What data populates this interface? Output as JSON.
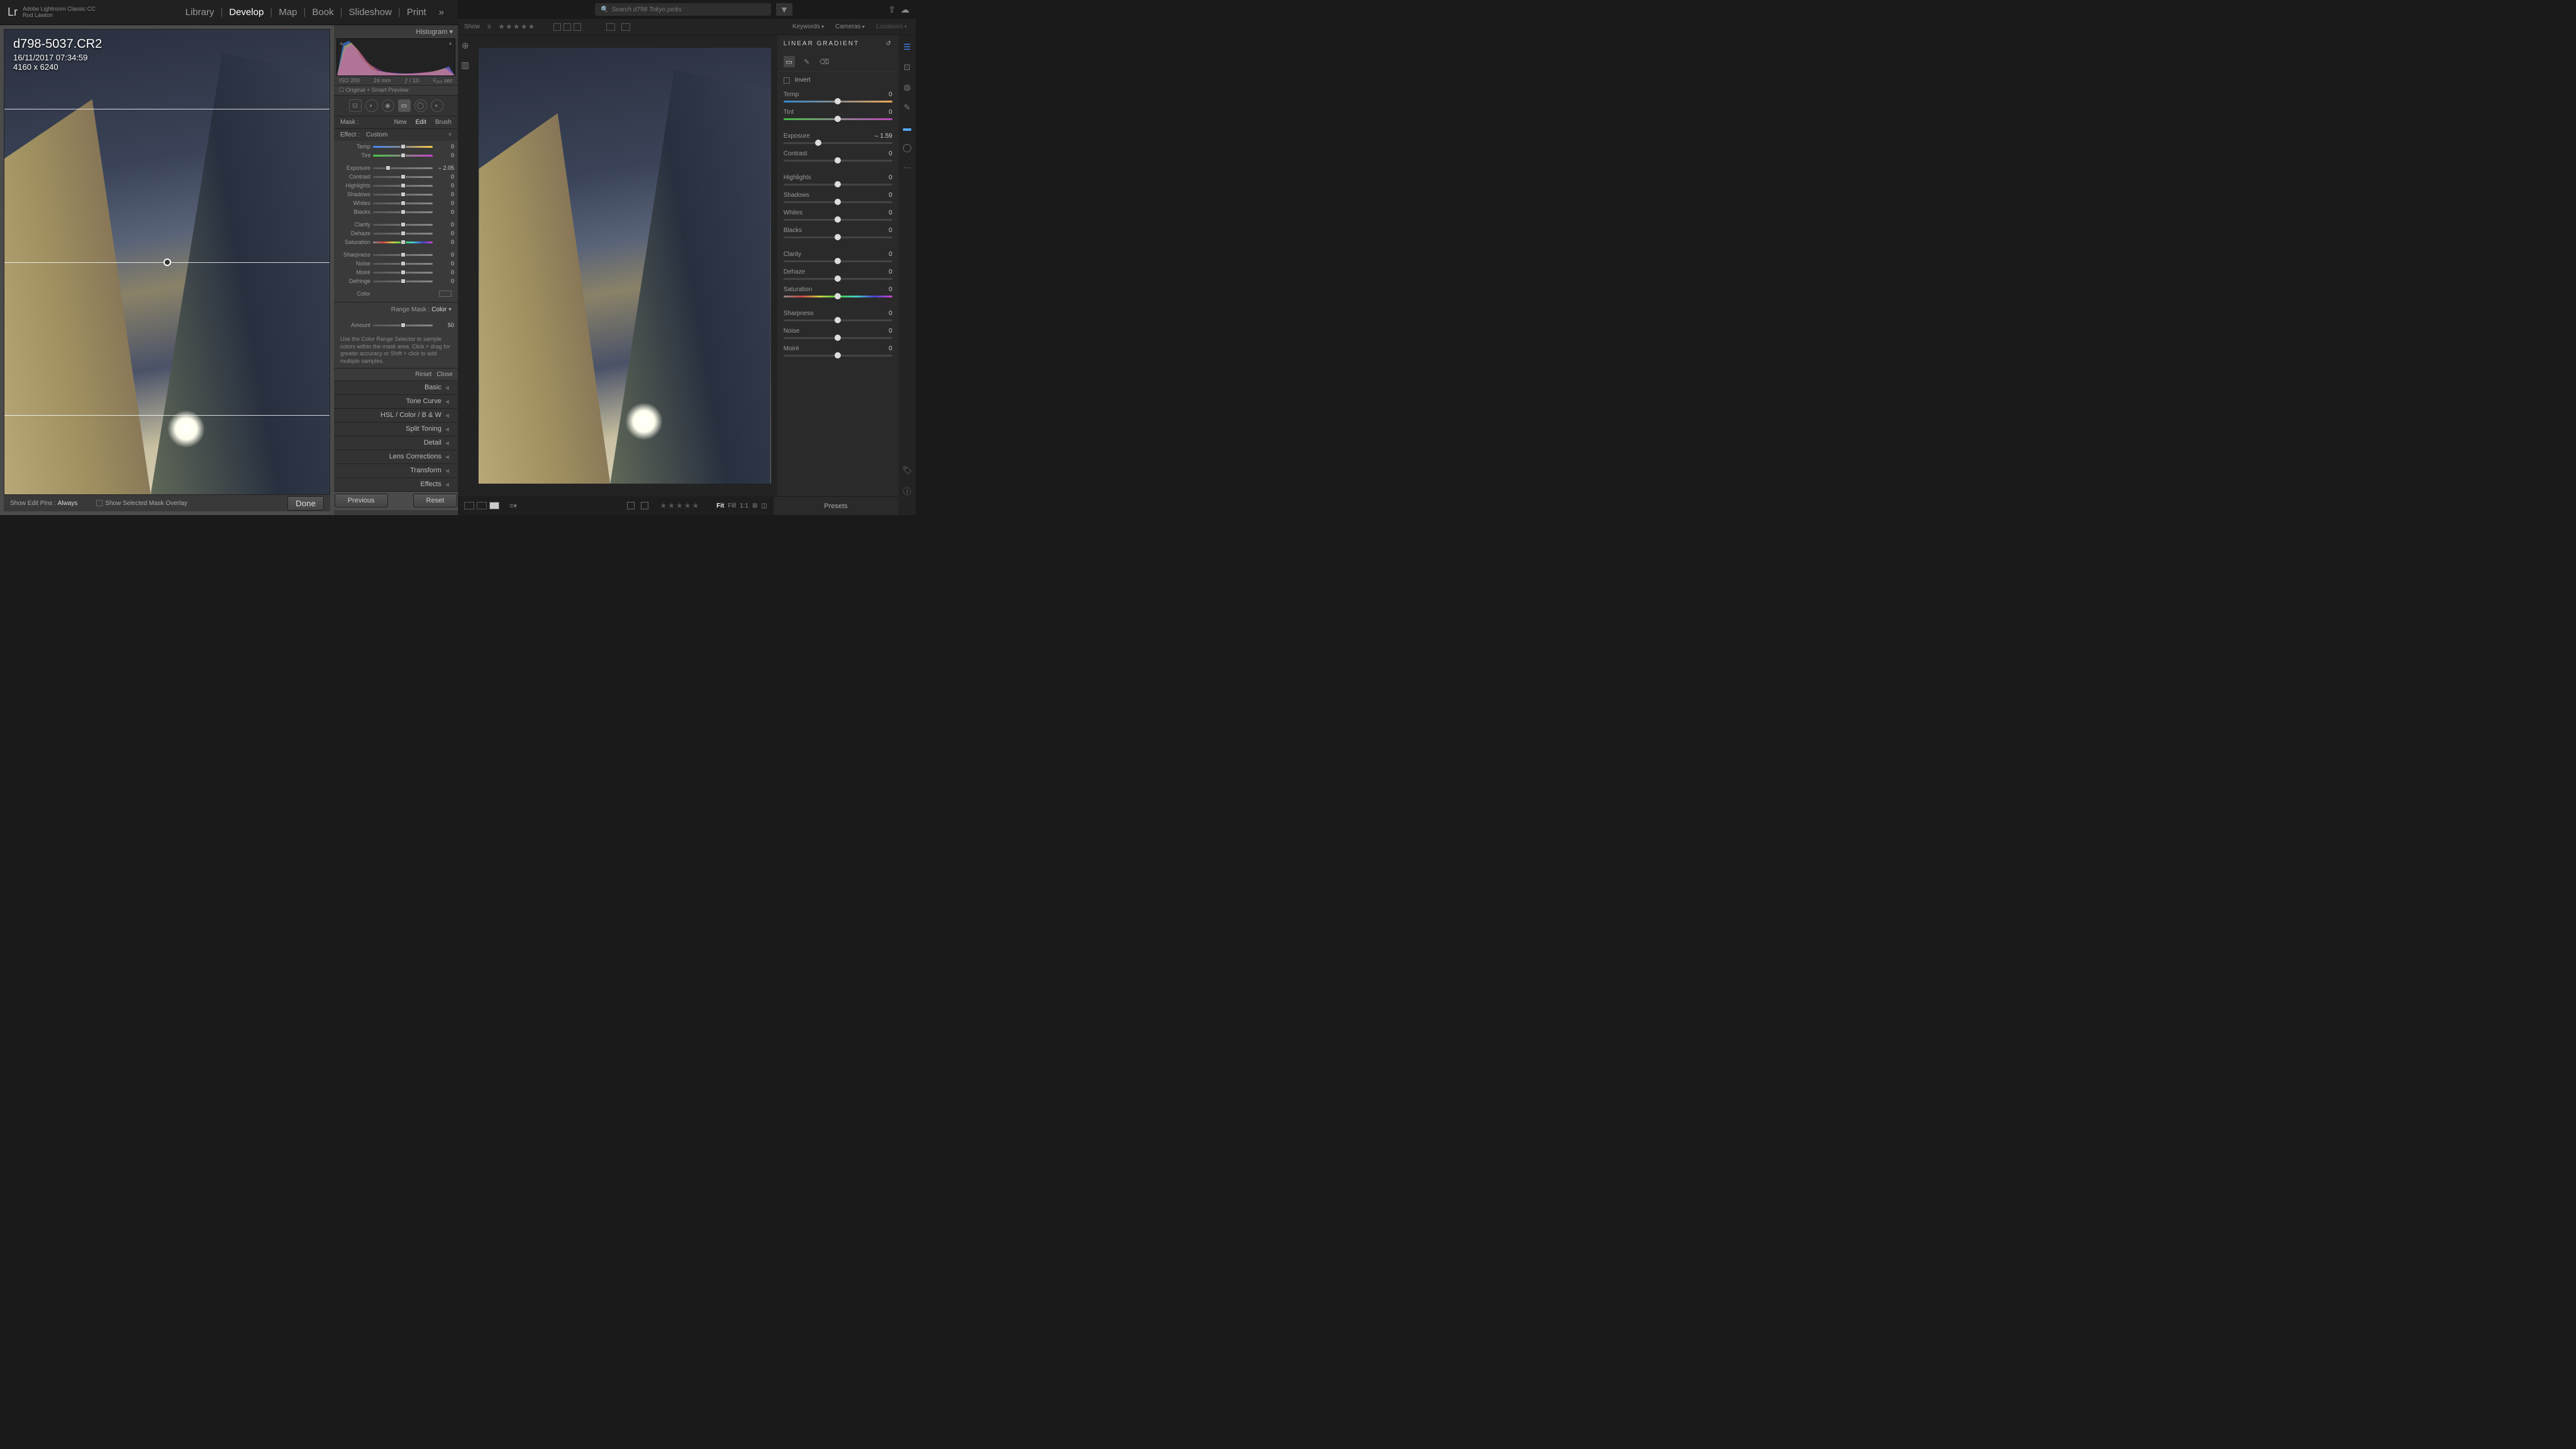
{
  "lrc": {
    "appName": "Adobe Lightroom Classic CC",
    "userName": "Rod Lawton",
    "logo": "Lr",
    "modules": [
      "Library",
      "Develop",
      "Map",
      "Book",
      "Slideshow",
      "Print"
    ],
    "activeModule": "Develop",
    "moreGlyph": "»",
    "image": {
      "filename": "d798-5037.CR2",
      "datetime": "16/11/2017 07:34:59",
      "dimensions": "4160 x 6240"
    },
    "histogramLabel": "Histogram ▾",
    "histInfo": {
      "iso": "ISO 200",
      "focal": "24 mm",
      "aperture": "ƒ / 10",
      "shutter": "¹⁄₂₅₀ sec"
    },
    "previewLabel": "☐ Original + Smart Preview",
    "mask": {
      "label": "Mask :",
      "new": "New",
      "edit": "Edit",
      "brush": "Brush"
    },
    "effect": {
      "label": "Effect :",
      "value": "Custom"
    },
    "sliders": [
      {
        "n": "Temp",
        "v": "0",
        "cls": "temp",
        "pos": 50
      },
      {
        "n": "Tint",
        "v": "0",
        "cls": "tint",
        "pos": 50
      },
      {
        "gap": true
      },
      {
        "n": "Exposure",
        "v": "– 2.05",
        "pos": 25
      },
      {
        "n": "Contrast",
        "v": "0",
        "pos": 50
      },
      {
        "n": "Highlights",
        "v": "0",
        "pos": 50
      },
      {
        "n": "Shadows",
        "v": "0",
        "pos": 50
      },
      {
        "n": "Whites",
        "v": "0",
        "pos": 50
      },
      {
        "n": "Blacks",
        "v": "0",
        "pos": 50
      },
      {
        "gap": true
      },
      {
        "n": "Clarity",
        "v": "0",
        "pos": 50
      },
      {
        "n": "Dehaze",
        "v": "0",
        "pos": 50
      },
      {
        "n": "Saturation",
        "v": "0",
        "cls": "sat",
        "pos": 50
      },
      {
        "gap": true
      },
      {
        "n": "Sharpness",
        "v": "0",
        "pos": 50
      },
      {
        "n": "Noise",
        "v": "0",
        "pos": 50
      },
      {
        "n": "Moiré",
        "v": "0",
        "pos": 50
      },
      {
        "n": "Defringe",
        "v": "0",
        "pos": 50
      },
      {
        "gap": true
      },
      {
        "n": "Color",
        "v": "",
        "pos": null,
        "swatch": true
      }
    ],
    "rangeMask": {
      "label": "Range Mask :",
      "value": "Color",
      "amount": "Amount",
      "amountVal": "50"
    },
    "help": "Use the Color Range Selector to sample colors within the mask area. Click + drag for greater accuracy or Shift + click to add multiple samples.",
    "resetRow": {
      "reset": "Reset",
      "close": "Close"
    },
    "panels": [
      "Basic",
      "Tone Curve",
      "HSL / Color / B & W",
      "Split Toning",
      "Detail",
      "Lens Corrections",
      "Transform",
      "Effects"
    ],
    "footer": {
      "showEditPins": "Show Edit Pins :",
      "always": "Always",
      "showOverlay": "Show Selected Mask Overlay",
      "done": "Done"
    },
    "bottomBar": {
      "prev": "Previous",
      "reset": "Reset"
    }
  },
  "cc": {
    "searchPlaceholder": "Search d798 Tokyo picks",
    "subBar": {
      "show": "Show",
      "ge": "≥"
    },
    "dropdowns": [
      "Keywords",
      "Cameras",
      "Locations"
    ],
    "panelTitle": "LINEAR GRADIENT",
    "invert": "Invert",
    "sliders": [
      {
        "n": "Temp",
        "v": "0",
        "cls": "temp",
        "pos": 50
      },
      {
        "n": "Tint",
        "v": "0",
        "cls": "tint",
        "pos": 50
      },
      {
        "gap": true
      },
      {
        "n": "Exposure",
        "v": "– 1.59",
        "pos": 32
      },
      {
        "n": "Contrast",
        "v": "0",
        "pos": 50
      },
      {
        "gap": true
      },
      {
        "n": "Highlights",
        "v": "0",
        "pos": 50
      },
      {
        "n": "Shadows",
        "v": "0",
        "pos": 50
      },
      {
        "n": "Whites",
        "v": "0",
        "pos": 50
      },
      {
        "n": "Blacks",
        "v": "0",
        "pos": 50
      },
      {
        "gap": true
      },
      {
        "n": "Clarity",
        "v": "0",
        "pos": 50
      },
      {
        "n": "Dehaze",
        "v": "0",
        "pos": 50
      },
      {
        "n": "Saturation",
        "v": "0",
        "cls": "sat",
        "pos": 50
      },
      {
        "gap": true
      },
      {
        "n": "Sharpness",
        "v": "0",
        "pos": 50
      },
      {
        "n": "Noise",
        "v": "0",
        "pos": 50
      },
      {
        "n": "Moiré",
        "v": "0",
        "pos": 50
      }
    ],
    "zoom": {
      "fit": "Fit",
      "fill": "Fill",
      "oneToOne": "1:1"
    },
    "presets": "Presets"
  }
}
